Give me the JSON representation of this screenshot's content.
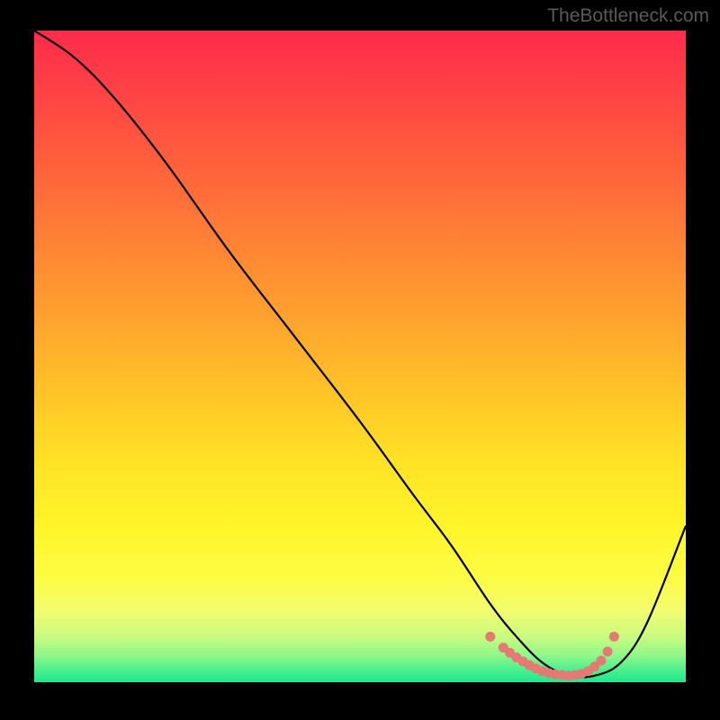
{
  "watermark": "TheBottleneck.com",
  "chart_data": {
    "type": "line",
    "title": "",
    "xlabel": "",
    "ylabel": "",
    "xlim": [
      0,
      100
    ],
    "ylim": [
      0,
      100
    ],
    "grid": false,
    "legend": false,
    "series": [
      {
        "name": "curve",
        "x": [
          0,
          6,
          12,
          20,
          30,
          40,
          50,
          58,
          64,
          70,
          74,
          78,
          82,
          86,
          90,
          94,
          100
        ],
        "y": [
          100,
          96,
          90,
          80,
          66,
          53,
          40,
          29,
          21,
          12,
          7,
          3,
          1,
          1,
          3,
          9,
          24
        ]
      }
    ],
    "markers": {
      "name": "highlight-dots",
      "x": [
        70,
        72,
        73,
        74,
        75,
        76,
        77,
        78,
        79,
        80,
        81,
        82,
        83,
        84,
        85,
        86,
        87,
        88,
        89
      ],
      "y": [
        7,
        5.3,
        4.5,
        3.8,
        3.2,
        2.6,
        2.1,
        1.7,
        1.4,
        1.2,
        1.1,
        1.0,
        1.1,
        1.3,
        1.7,
        2.4,
        3.3,
        4.7,
        7.0
      ]
    },
    "background": {
      "type": "vertical-gradient",
      "stops": [
        {
          "pos": 0.0,
          "color": "#ff2b4a"
        },
        {
          "pos": 0.5,
          "color": "#ffb22b"
        },
        {
          "pos": 0.8,
          "color": "#fff83a"
        },
        {
          "pos": 1.0,
          "color": "#1ee98f"
        }
      ]
    }
  }
}
